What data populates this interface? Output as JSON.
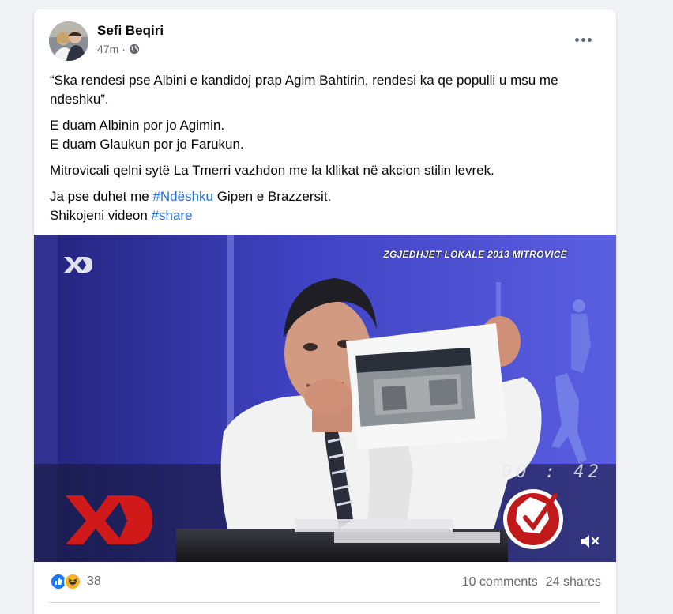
{
  "post": {
    "author": "Sefi Beqiri",
    "time": "47m",
    "separator": "·",
    "privacy_icon": "globe-icon",
    "more_icon": "more-options-icon",
    "paragraphs": {
      "p1": "“Ska rendesi pse Albini e kandidoj prap Agim Bahtirin, rendesi ka qe populli u msu me ndeshku”.",
      "p2a": "E duam Albinin por jo Agimin.",
      "p2b": "E duam Glaukun por jo Farukun.",
      "p3": "Mitrovicali qelni sytë La Tmerri vazhdon me la kllikat në akcion stilin levrek.",
      "p4a_pre": "Ja pse duhet me ",
      "p4a_tag": "#Ndëshku",
      "p4a_post": " Gipen e Brazzersit.",
      "p4b_pre": "Shikojeni videon ",
      "p4b_tag": "#share"
    }
  },
  "video": {
    "overlay_title": "ZGJEDHJET LOKALE 2013 MITROVICË",
    "timer": "00 : 42",
    "mute_icon": "volume-muted-icon",
    "logo_icon": "xd-logo-icon"
  },
  "stats": {
    "reaction_icons": [
      "like-icon",
      "haha-icon"
    ],
    "reaction_count": "38",
    "comments": "10 comments",
    "shares": "24 shares"
  },
  "colors": {
    "link": "#216fdb",
    "secondary_text": "#65676b",
    "like_blue": "#1877f2",
    "haha_yellow": "#f7b125"
  }
}
